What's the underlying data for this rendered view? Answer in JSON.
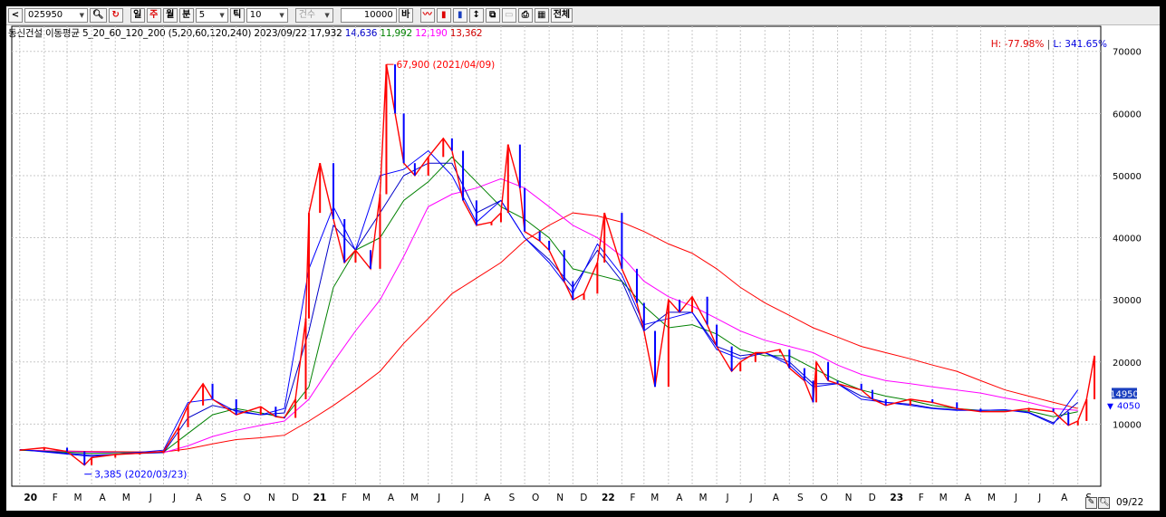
{
  "toolbar": {
    "prev_arrow": "<",
    "code": "025950",
    "period_day": "일",
    "period_week": "주",
    "period_month": "월",
    "period_min": "분",
    "min_value": "5",
    "tick_label": "틱",
    "tick_value": "10",
    "count_label": "건수",
    "count_value": "10000",
    "count_unit": "바",
    "all_label": "전체"
  },
  "info": {
    "name": "동신건설 이동평균 5_20_60_120_200",
    "params": "(5,20,60,120,240)",
    "date": "2023/09/22",
    "ma5": "17,932",
    "ma20": "14,636",
    "ma60": "11,992",
    "ma120": "12,190",
    "ma240": "13,362"
  },
  "hl": {
    "high": "H: -77.98%",
    "low": "L: 341.65%"
  },
  "colors": {
    "ma5": "#0000ff",
    "ma20": "#0000c8",
    "ma60": "#008000",
    "ma120": "#ff00ff",
    "ma240": "#ff0000",
    "up": "#ff0000",
    "down": "#0000ff"
  },
  "annotations": {
    "max_label": "67,900 (2021/04/09)",
    "min_label": "3,385 (2020/03/23)",
    "current_price": "14950",
    "change": "4050"
  },
  "footer": {
    "date": "09/22"
  },
  "chart_data": {
    "type": "line",
    "title": "",
    "xlabel": "",
    "ylabel": "",
    "ylim": [
      0,
      72000
    ],
    "y_ticks": [
      10000,
      20000,
      30000,
      40000,
      50000,
      60000,
      70000
    ],
    "x_ticks": [
      "20",
      "F",
      "M",
      "A",
      "M",
      "J",
      "J",
      "A",
      "S",
      "O",
      "N",
      "D",
      "21",
      "F",
      "M",
      "A",
      "M",
      "J",
      "J",
      "A",
      "S",
      "O",
      "N",
      "D",
      "22",
      "F",
      "M",
      "A",
      "M",
      "J",
      "J",
      "A",
      "S",
      "O",
      "N",
      "D",
      "23",
      "F",
      "M",
      "A",
      "M",
      "J",
      "J",
      "A",
      "S"
    ],
    "grid": true,
    "legend": "none",
    "months": [
      "2020-01",
      "2020-02",
      "2020-03",
      "2020-04",
      "2020-05",
      "2020-06",
      "2020-07",
      "2020-08",
      "2020-09",
      "2020-10",
      "2020-11",
      "2020-12",
      "2021-01",
      "2021-02",
      "2021-03",
      "2021-04",
      "2021-05",
      "2021-06",
      "2021-07",
      "2021-08",
      "2021-09",
      "2021-10",
      "2021-11",
      "2021-12",
      "2022-01",
      "2022-02",
      "2022-03",
      "2022-04",
      "2022-05",
      "2022-06",
      "2022-07",
      "2022-08",
      "2022-09",
      "2022-10",
      "2022-11",
      "2022-12",
      "2023-01",
      "2023-02",
      "2023-03",
      "2023-04",
      "2023-05",
      "2023-06",
      "2023-07",
      "2023-08",
      "2023-09"
    ],
    "price": {
      "x": [
        "2020-01",
        "2020-02",
        "2020-03",
        "2020-03-23",
        "2020-04",
        "2020-05",
        "2020-06",
        "2020-07",
        "2020-07-20",
        "2020-08",
        "2020-08-20",
        "2020-09",
        "2020-10",
        "2020-11",
        "2020-11-20",
        "2020-12",
        "2020-12-15",
        "2020-12-28",
        "2021-01",
        "2021-01-15",
        "2021-02",
        "2021-02-15",
        "2021-03",
        "2021-03-20",
        "2021-04",
        "2021-04-09",
        "2021-04-20",
        "2021-05",
        "2021-05-15",
        "2021-06",
        "2021-06-20",
        "2021-07",
        "2021-07-15",
        "2021-08",
        "2021-08-20",
        "2021-09",
        "2021-09-10",
        "2021-09-25",
        "2021-10",
        "2021-10-20",
        "2021-11",
        "2021-11-20",
        "2021-12",
        "2021-12-15",
        "2022-01",
        "2022-01-10",
        "2022-02",
        "2022-02-20",
        "2022-03",
        "2022-03-15",
        "2022-04",
        "2022-04-15",
        "2022-05",
        "2022-05-20",
        "2022-06",
        "2022-06-20",
        "2022-07",
        "2022-07-20",
        "2022-08",
        "2022-08-20",
        "2022-09",
        "2022-09-20",
        "2022-10",
        "2022-10-05",
        "2022-10-20",
        "2022-11",
        "2022-12",
        "2022-12-15",
        "2023-01",
        "2023-02",
        "2023-03",
        "2023-04",
        "2023-05",
        "2023-06",
        "2023-07",
        "2023-08",
        "2023-08-20",
        "2023-09",
        "2023-09-12",
        "2023-09-22"
      ],
      "y": [
        5800,
        6200,
        5600,
        3400,
        4600,
        5100,
        5300,
        5600,
        9500,
        13000,
        16500,
        14000,
        11500,
        12800,
        11200,
        11000,
        14000,
        27000,
        44000,
        52000,
        43000,
        36000,
        38000,
        35000,
        47000,
        67900,
        60000,
        52000,
        50000,
        53000,
        56000,
        54000,
        46000,
        42000,
        42500,
        44000,
        55000,
        48000,
        41000,
        39500,
        38000,
        33000,
        30000,
        31000,
        36000,
        44000,
        35000,
        29500,
        25000,
        16000,
        30000,
        28000,
        30500,
        26000,
        22500,
        18500,
        20000,
        21500,
        21500,
        22000,
        19000,
        17000,
        13500,
        20000,
        17000,
        16500,
        15500,
        14000,
        13000,
        14000,
        13500,
        12500,
        12000,
        12000,
        12500,
        12000,
        9800,
        10500,
        14000,
        21000,
        14950
      ]
    },
    "series": [
      {
        "x": [
          "2020-01",
          "2020-04",
          "2020-07",
          "2020-08",
          "2020-09",
          "2020-10",
          "2020-11",
          "2020-12",
          "2021-01",
          "2021-02",
          "2021-03",
          "2021-04",
          "2021-05",
          "2021-06",
          "2021-07",
          "2021-08",
          "2021-09",
          "2021-10",
          "2021-11",
          "2021-12",
          "2022-01",
          "2022-02",
          "2022-03",
          "2022-04",
          "2022-05",
          "2022-06",
          "2022-07",
          "2022-08",
          "2022-09",
          "2022-10",
          "2022-11",
          "2022-12",
          "2023-01",
          "2023-02",
          "2023-03",
          "2023-04",
          "2023-05",
          "2023-06",
          "2023-07",
          "2023-08",
          "2023-09"
        ],
        "values": [
          5900,
          4800,
          5800,
          13500,
          14000,
          12000,
          11500,
          12500,
          35000,
          45000,
          38000,
          50000,
          51000,
          54000,
          50000,
          42500,
          46000,
          40000,
          36000,
          31000,
          39000,
          34000,
          26000,
          27000,
          28000,
          22000,
          20500,
          21500,
          19500,
          16000,
          16500,
          14000,
          13500,
          13000,
          12500,
          12200,
          12200,
          12300,
          11800,
          10000,
          15500
        ]
      },
      {
        "x": [
          "2020-01",
          "2020-04",
          "2020-07",
          "2020-08",
          "2020-09",
          "2020-10",
          "2020-11",
          "2020-12",
          "2021-01",
          "2021-02",
          "2021-03",
          "2021-04",
          "2021-05",
          "2021-06",
          "2021-07",
          "2021-08",
          "2021-09",
          "2021-10",
          "2021-11",
          "2021-12",
          "2022-01",
          "2022-02",
          "2022-03",
          "2022-04",
          "2022-05",
          "2022-06",
          "2022-07",
          "2022-08",
          "2022-09",
          "2022-10",
          "2022-11",
          "2022-12",
          "2023-01",
          "2023-02",
          "2023-03",
          "2023-04",
          "2023-05",
          "2023-06",
          "2023-07",
          "2023-08",
          "2023-09"
        ],
        "values": [
          5900,
          5000,
          5400,
          11000,
          13000,
          12200,
          11500,
          11800,
          25000,
          42000,
          38000,
          44000,
          50000,
          52000,
          52000,
          44000,
          46000,
          40000,
          36500,
          32000,
          38000,
          33000,
          25000,
          28000,
          28000,
          22500,
          21000,
          21500,
          20000,
          16500,
          16500,
          14500,
          13500,
          13200,
          12600,
          12300,
          12200,
          12300,
          11900,
          10200,
          13500
        ]
      },
      {
        "x": [
          "2020-01",
          "2020-04",
          "2020-07",
          "2020-08",
          "2020-09",
          "2020-10",
          "2020-11",
          "2020-12",
          "2021-01",
          "2021-02",
          "2021-03",
          "2021-04",
          "2021-05",
          "2021-06",
          "2021-07",
          "2021-08",
          "2021-09",
          "2021-10",
          "2021-11",
          "2021-12",
          "2022-01",
          "2022-02",
          "2022-03",
          "2022-04",
          "2022-05",
          "2022-06",
          "2022-07",
          "2022-08",
          "2022-09",
          "2022-10",
          "2022-11",
          "2022-12",
          "2023-01",
          "2023-02",
          "2023-03",
          "2023-04",
          "2023-05",
          "2023-06",
          "2023-07",
          "2023-08",
          "2023-09"
        ],
        "values": [
          5800,
          5300,
          5500,
          8500,
          11500,
          12500,
          11800,
          11000,
          16000,
          32000,
          38000,
          40000,
          46000,
          49000,
          53000,
          49000,
          45000,
          43000,
          40000,
          35000,
          34000,
          33000,
          29000,
          25500,
          26000,
          24500,
          22000,
          21000,
          21000,
          19000,
          17000,
          15500,
          14500,
          13800,
          13000,
          12500,
          12200,
          12200,
          12100,
          11200,
          12000
        ]
      },
      {
        "x": [
          "2020-01",
          "2020-04",
          "2020-07",
          "2020-08",
          "2020-09",
          "2020-10",
          "2020-11",
          "2020-12",
          "2021-01",
          "2021-02",
          "2021-03",
          "2021-04",
          "2021-05",
          "2021-06",
          "2021-07",
          "2021-08",
          "2021-09",
          "2021-10",
          "2021-11",
          "2021-12",
          "2022-01",
          "2022-02",
          "2022-03",
          "2022-04",
          "2022-05",
          "2022-06",
          "2022-07",
          "2022-08",
          "2022-09",
          "2022-10",
          "2022-11",
          "2022-12",
          "2023-01",
          "2023-02",
          "2023-03",
          "2023-04",
          "2023-05",
          "2023-06",
          "2023-07",
          "2023-08",
          "2023-09"
        ],
        "values": [
          5800,
          5500,
          5400,
          6500,
          8000,
          9000,
          9800,
          10500,
          14000,
          20000,
          25000,
          30000,
          37000,
          45000,
          47000,
          48000,
          49500,
          48000,
          45000,
          42000,
          40000,
          37000,
          33000,
          30500,
          29000,
          27000,
          25000,
          23500,
          22500,
          21500,
          19500,
          18000,
          17000,
          16500,
          16000,
          15500,
          15000,
          14200,
          13500,
          12500,
          12200
        ]
      },
      {
        "x": [
          "2020-01",
          "2020-04",
          "2020-07",
          "2020-08",
          "2020-09",
          "2020-10",
          "2020-11",
          "2020-12",
          "2021-01",
          "2021-02",
          "2021-03",
          "2021-04",
          "2021-05",
          "2021-06",
          "2021-07",
          "2021-08",
          "2021-09",
          "2021-10",
          "2021-11",
          "2021-12",
          "2022-01",
          "2022-02",
          "2022-03",
          "2022-04",
          "2022-05",
          "2022-06",
          "2022-07",
          "2022-08",
          "2022-09",
          "2022-10",
          "2022-11",
          "2022-12",
          "2023-01",
          "2023-02",
          "2023-03",
          "2023-04",
          "2023-05",
          "2023-06",
          "2023-07",
          "2023-08",
          "2023-09"
        ],
        "values": [
          5800,
          5600,
          5500,
          6000,
          6800,
          7500,
          7800,
          8200,
          10500,
          13000,
          15500,
          18500,
          23000,
          27000,
          31000,
          33500,
          36000,
          39500,
          42000,
          44000,
          43500,
          42500,
          41000,
          39000,
          37500,
          35000,
          32000,
          29500,
          27500,
          25500,
          24000,
          22500,
          21500,
          20500,
          19500,
          18500,
          17000,
          15500,
          14500,
          13500,
          12500
        ]
      }
    ]
  }
}
